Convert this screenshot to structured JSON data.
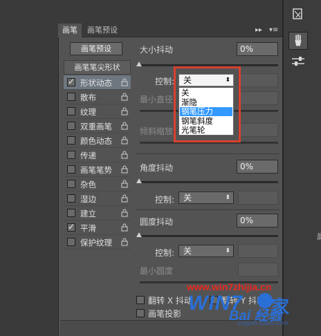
{
  "tabs": {
    "brush": "画笔",
    "brush_presets": "画笔预设",
    "collapse": "▸▸",
    "menu": "▾≡"
  },
  "preset_button": "画笔预设",
  "list_header": "画笔笔尖形状",
  "list_items": [
    {
      "label": "形状动态",
      "checked": true,
      "selected": true
    },
    {
      "label": "散布",
      "checked": false,
      "selected": false
    },
    {
      "label": "纹理",
      "checked": false,
      "selected": false
    },
    {
      "label": "双重画笔",
      "checked": false,
      "selected": false
    },
    {
      "label": "颜色动态",
      "checked": false,
      "selected": false
    },
    {
      "label": "传递",
      "checked": false,
      "selected": false
    },
    {
      "label": "画笔笔势",
      "checked": false,
      "selected": false
    },
    {
      "label": "杂色",
      "checked": false,
      "selected": false
    },
    {
      "label": "湿边",
      "checked": false,
      "selected": false
    },
    {
      "label": "建立",
      "checked": false,
      "selected": false
    },
    {
      "label": "平滑",
      "checked": true,
      "selected": false
    },
    {
      "label": "保护纹理",
      "checked": false,
      "selected": false
    }
  ],
  "size_jitter": {
    "label": "大小抖动",
    "value": "0%"
  },
  "control1": {
    "label": "控制:",
    "value": "关"
  },
  "min_diameter": {
    "label": "最小直径"
  },
  "tilt_scale": {
    "label": "倾斜缩放"
  },
  "dropdown": {
    "options": [
      "关",
      "渐隐",
      "钢笔压力",
      "钢笔斜度",
      "光笔轮"
    ],
    "highlighted": 2
  },
  "angle_jitter": {
    "label": "角度抖动",
    "value": "0%"
  },
  "control2": {
    "label": "控制:",
    "value": "关"
  },
  "roundness_jitter": {
    "label": "圆度抖动",
    "value": "0%"
  },
  "control3": {
    "label": "控制:",
    "value": "关"
  },
  "min_roundness": {
    "label": "最小圆度"
  },
  "flip_x": {
    "label": "翻转 X 抖动"
  },
  "flip_y": {
    "label": "翻转 Y 抖动"
  },
  "brush_projection": {
    "label": "画笔投影"
  },
  "right_edge_text": "属",
  "watermark": {
    "url": "www.win7zhijia.cn",
    "logo": "WIN7",
    "char": "家",
    "baidu": "Bai 经验",
    "small": "jingyan.baidu.com"
  },
  "colors": {
    "highlight": "#3399ff",
    "annotation_red": "#d9412e",
    "watermark_red": "#e62a1f",
    "watermark_blue": "#2a6fd6"
  }
}
